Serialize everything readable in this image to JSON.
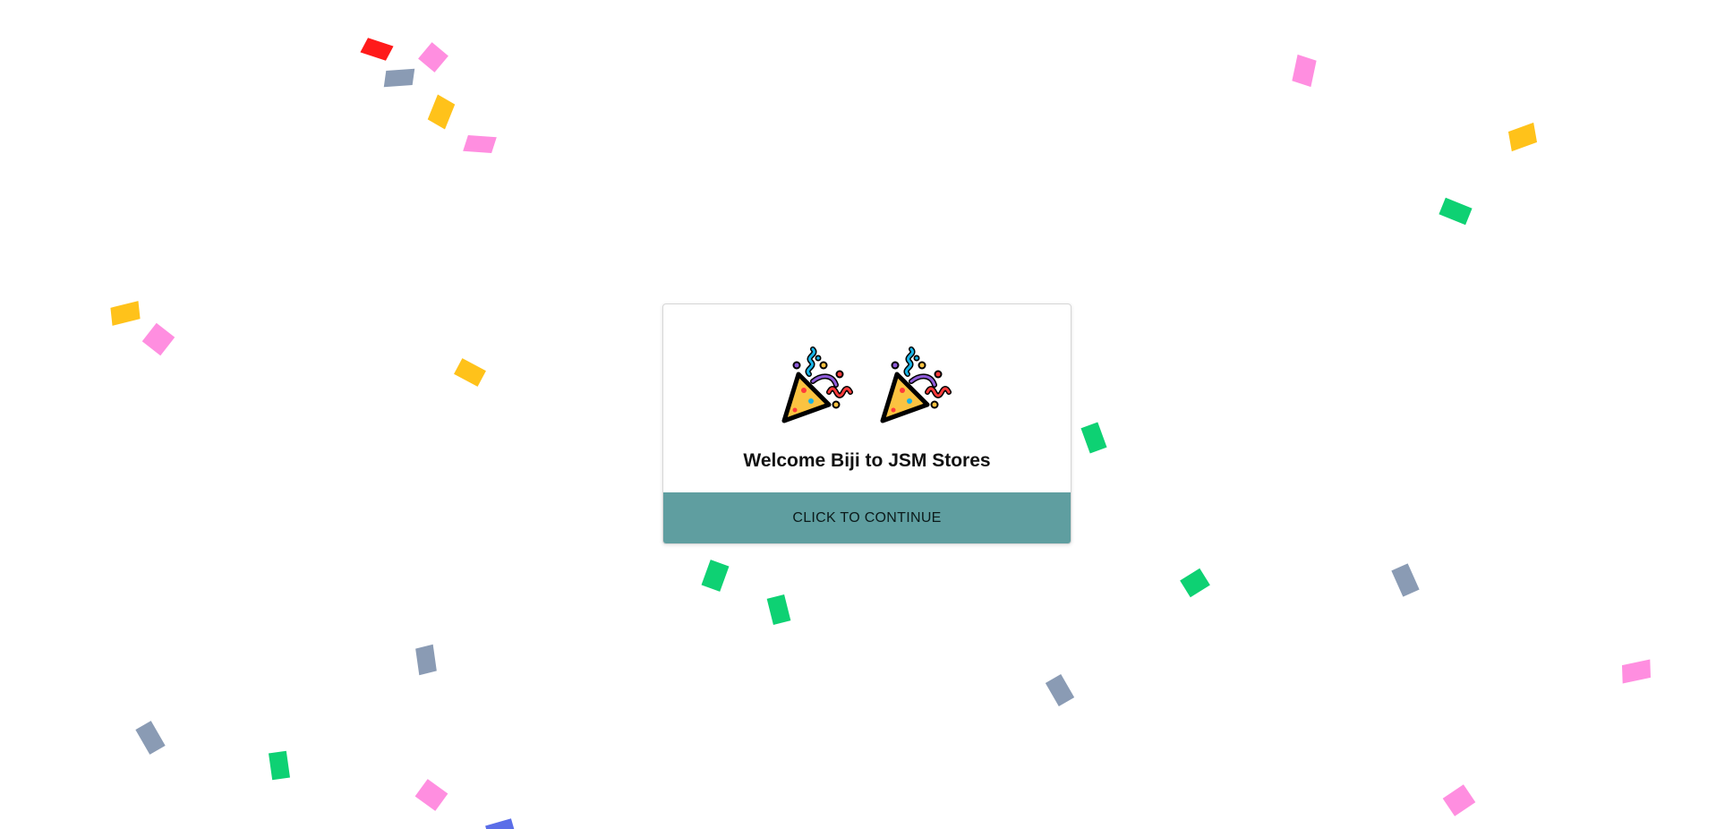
{
  "dialog": {
    "emojis": [
      "party-popper-icon",
      "party-popper-icon"
    ],
    "welcome_text": "Welcome Biji to JSM Stores",
    "continue_label": "CLICK TO CONTINUE",
    "button_color": "#5f9ea0"
  },
  "confetti_colors": {
    "red": "#ff1a1a",
    "pink": "#ff8ee0",
    "slate": "#8a9bb4",
    "yellow": "#ffc21a",
    "green": "#0ed173",
    "blue": "#5b6ee8"
  }
}
